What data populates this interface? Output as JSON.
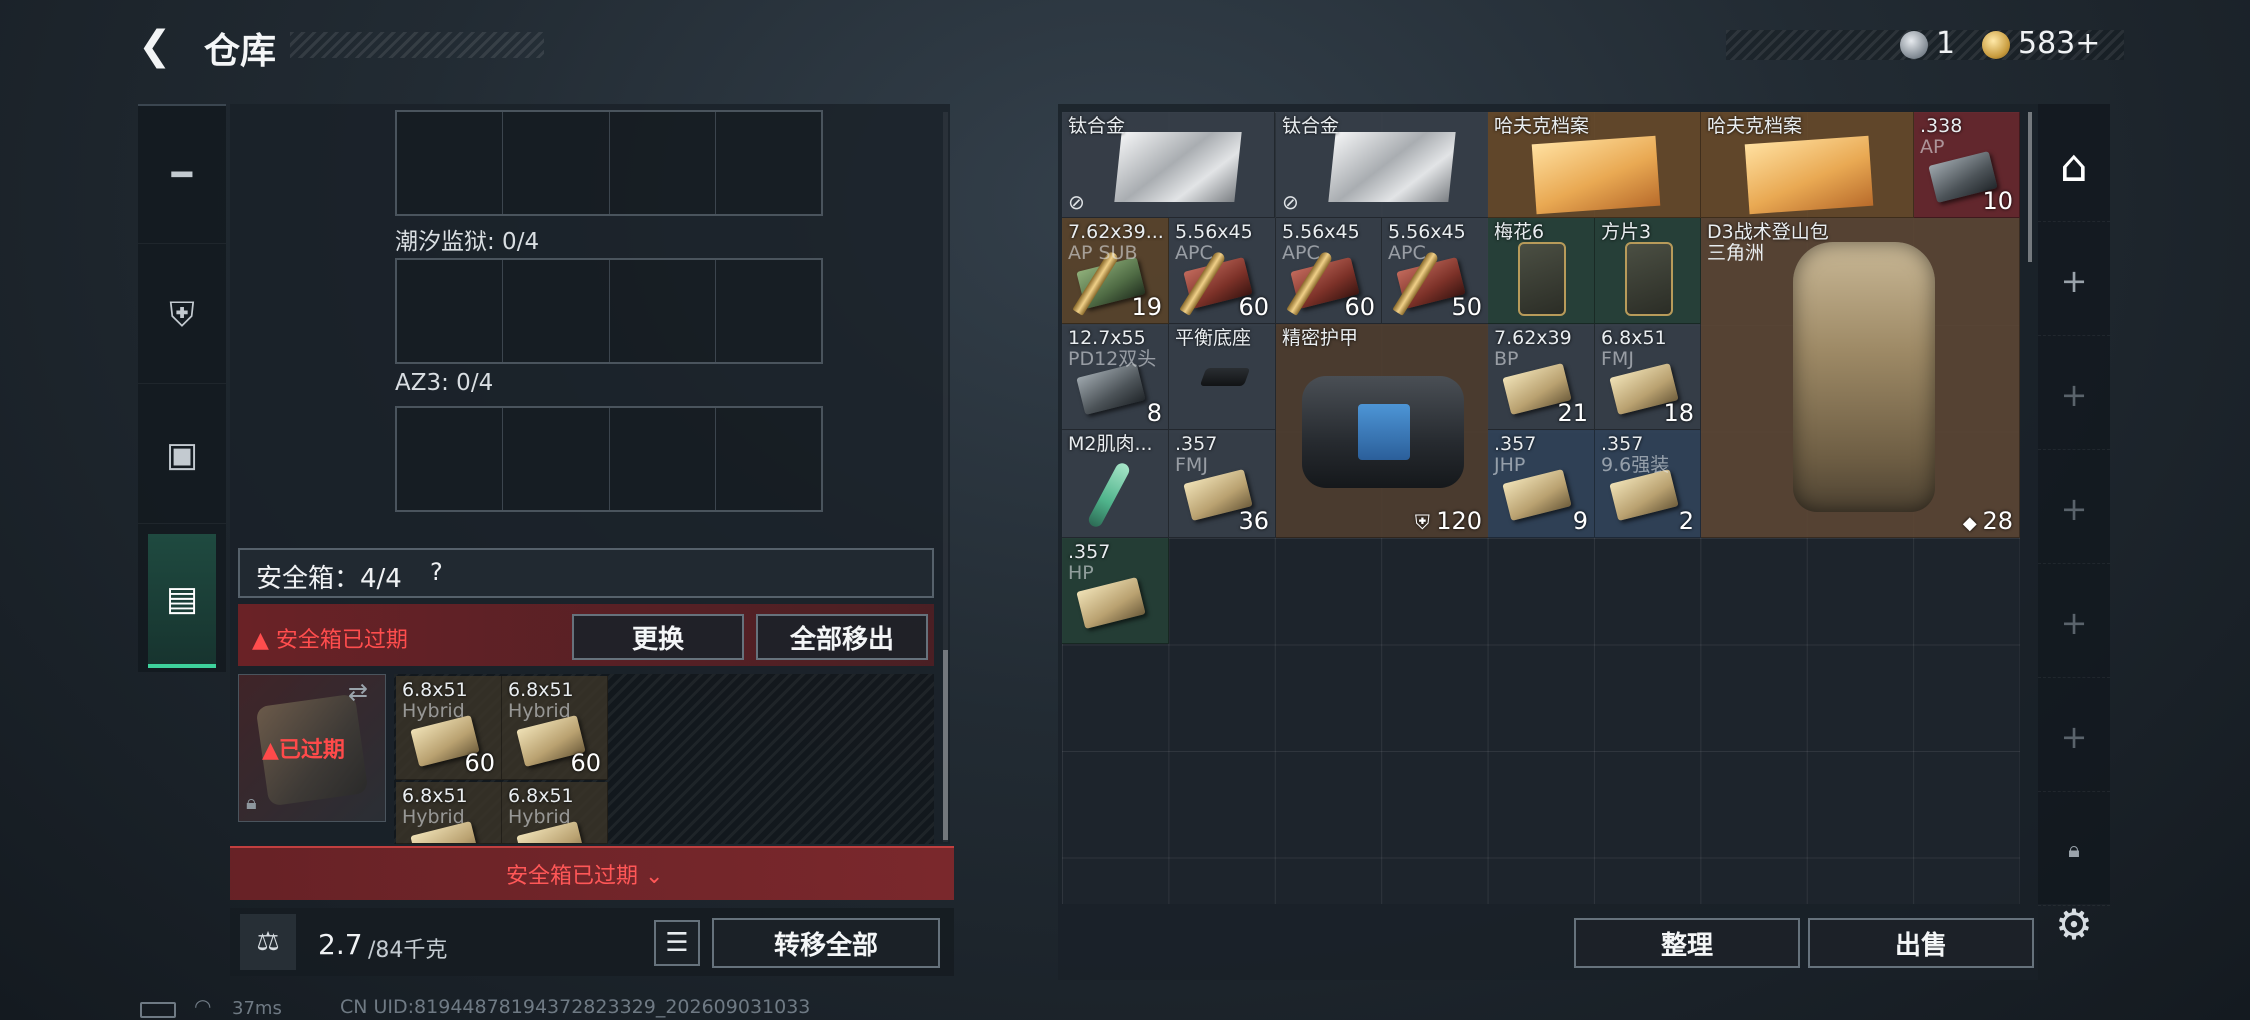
{
  "header": {
    "back_icon": "back-arrow-icon",
    "title": "仓库",
    "currency1_value": "1",
    "currency2_value": "583",
    "currency2_plus": "+"
  },
  "left_tabs": [
    {
      "name": "weapons",
      "icon": "gun-icon"
    },
    {
      "name": "armor",
      "icon": "armor-icon"
    },
    {
      "name": "rig",
      "icon": "backpack-icon"
    },
    {
      "name": "safebox",
      "icon": "briefcase-icon",
      "active": true
    }
  ],
  "containers": {
    "label_1": "潮汐监狱: 0/4",
    "label_2": "AZ3: 0/4"
  },
  "safebox": {
    "title": "安全箱：4/4",
    "help": "?",
    "expired_notice": "安全箱已过期",
    "replace_label": "更换",
    "move_all_label": "全部移出",
    "case_expired": "已过期",
    "bottom_notice": "安全箱已过期",
    "items": [
      {
        "name": "6.8x51",
        "sub": "Hybrid",
        "count": "60"
      },
      {
        "name": "6.8x51",
        "sub": "Hybrid",
        "count": "60"
      },
      {
        "name": "6.8x51",
        "sub": "Hybrid",
        "count": ""
      },
      {
        "name": "6.8x51",
        "sub": "Hybrid",
        "count": ""
      }
    ]
  },
  "weight": {
    "current": "2.7",
    "max": "/84千克",
    "transfer_label": "转移全部"
  },
  "inventory": {
    "items": [
      {
        "name": "钛合金",
        "sub": "",
        "count": ""
      },
      {
        "name": "钛合金",
        "sub": "",
        "count": ""
      },
      {
        "name": "哈夫克档案",
        "sub": "",
        "count": ""
      },
      {
        "name": "哈夫克档案",
        "sub": "",
        "count": ""
      },
      {
        "name": ".338",
        "sub": "AP",
        "count": "10"
      },
      {
        "name": "7.62x39...",
        "sub": "AP SUB",
        "count": "19"
      },
      {
        "name": "5.56x45",
        "sub": "APC",
        "count": "60"
      },
      {
        "name": "5.56x45",
        "sub": "APC",
        "count": "60"
      },
      {
        "name": "5.56x45",
        "sub": "APC",
        "count": "50"
      },
      {
        "name": "梅花6",
        "sub": "",
        "count": ""
      },
      {
        "name": "方片3",
        "sub": "",
        "count": ""
      },
      {
        "name": "D3战术登山包",
        "sub": "三角洲",
        "count": "28"
      },
      {
        "name": "12.7x55",
        "sub": "PD12双头",
        "count": "8"
      },
      {
        "name": "平衡底座",
        "sub": "",
        "count": ""
      },
      {
        "name": "精密护甲",
        "sub": "",
        "count": "120"
      },
      {
        "name": "7.62x39",
        "sub": "BP",
        "count": "21"
      },
      {
        "name": "6.8x51",
        "sub": "FMJ",
        "count": "18"
      },
      {
        "name": "M2肌肉...",
        "sub": "",
        "count": ""
      },
      {
        "name": ".357",
        "sub": "FMJ",
        "count": "36"
      },
      {
        "name": ".357",
        "sub": "JHP",
        "count": "9"
      },
      {
        "name": ".357",
        "sub": "9.6强装",
        "count": "2"
      },
      {
        "name": ".357",
        "sub": "HP",
        "count": ""
      }
    ],
    "sort_label": "整理",
    "sell_label": "出售"
  },
  "status": {
    "ping": "37ms",
    "uid": "CN UID:81944878194372823329_202609031033"
  }
}
